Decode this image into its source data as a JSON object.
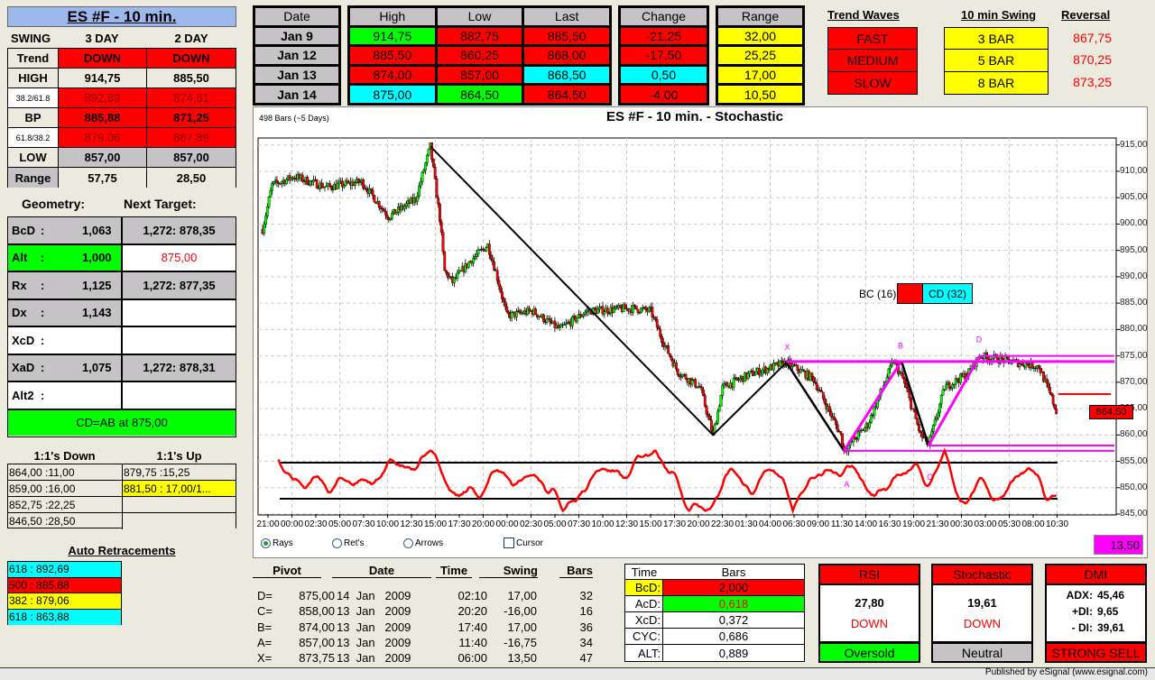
{
  "title": "ES #F - 10 min.",
  "swing": {
    "label": "SWING",
    "col1": "3 DAY",
    "col2": "2 DAY",
    "rows": [
      {
        "label": "Trend",
        "v1": "DOWN",
        "v2": "DOWN",
        "bg": "#ff0000",
        "lbg": "#ece9df",
        "fg": "#000"
      },
      {
        "label": "HIGH",
        "v1": "914,75",
        "v2": "885,50",
        "bg": "#ece9df",
        "lbg": "#ece9df",
        "fg": "#000"
      },
      {
        "label": "38.2/61.8",
        "v1": "892,69",
        "v2": "874,61",
        "bg": "#ff0000",
        "lbg": "#ffffff",
        "fg": "#800000",
        "small": true
      },
      {
        "label": "BP",
        "v1": "885,88",
        "v2": "871,25",
        "bg": "#ff0000",
        "lbg": "#ece9df",
        "fg": "#000"
      },
      {
        "label": "61.8/38.2",
        "v1": "879,06",
        "v2": "867,89",
        "bg": "#ff0000",
        "lbg": "#ffffff",
        "fg": "#800000",
        "small": true
      },
      {
        "label": "LOW",
        "v1": "857,00",
        "v2": "857,00",
        "bg": "#c6c3c6",
        "lbg": "#ece9df",
        "fg": "#000"
      },
      {
        "label": "Range",
        "v1": "57,75",
        "v2": "28,50",
        "bg": "#ece9df",
        "lbg": "#c6c3c6",
        "fg": "#000"
      }
    ]
  },
  "geometry": {
    "label": "Geometry:",
    "next_label": "Next Target:",
    "rows": [
      {
        "name": "BcD",
        "sep": ":",
        "value": "1,063",
        "target": "1,272: 878,35",
        "bg": "#c6c3c6",
        "tbg": "#c6c3c6",
        "tfg": "#000"
      },
      {
        "name": "Alt",
        "sep": ":",
        "value": "1,000",
        "target": "875,00",
        "bg": "#00ff00",
        "tbg": "#ffffff",
        "tfg": "#ff0000"
      },
      {
        "name": "Rx",
        "sep": ":",
        "value": "1,125",
        "target": "1,272: 877,35",
        "bg": "#c6c3c6",
        "tbg": "#c6c3c6",
        "tfg": "#000"
      },
      {
        "name": "Dx",
        "sep": ":",
        "value": "1,143",
        "target": "",
        "bg": "#c6c3c6",
        "tbg": "#ffffff",
        "tfg": "#000"
      },
      {
        "name": "XcD",
        "sep": ":",
        "value": "",
        "target": "",
        "bg": "#ffffff",
        "tbg": "#ffffff",
        "tfg": "#000"
      },
      {
        "name": "XaD",
        "sep": ":",
        "value": "1,075",
        "target": "1,272: 878,31",
        "bg": "#c6c3c6",
        "tbg": "#c6c3c6",
        "tfg": "#000"
      },
      {
        "name": "Alt2",
        "sep": ":",
        "value": "",
        "target": "",
        "bg": "#ffffff",
        "tbg": "#ffffff",
        "tfg": "#000"
      }
    ],
    "footer": "CD=AB at 875,00"
  },
  "ones": {
    "down_label": "1:1's Down",
    "up_label": "1:1's Up",
    "down": [
      "864,00 :11,00",
      "859,00 :16,00",
      "852,75 :22,25",
      "846,50 :28,50"
    ],
    "up": [
      "879,75 :15,25",
      "881,50 : 17,00/1...",
      "",
      ""
    ],
    "up_bg": [
      "#ece9df",
      "#ffff00",
      "#ece9df",
      "#ece9df"
    ]
  },
  "retracements": {
    "label": "Auto Retracements",
    "items": [
      {
        "text": "618 : 892,69",
        "bg": "#00ffff"
      },
      {
        "text": "500 : 885,88",
        "bg": "#ff0000"
      },
      {
        "text": "382 : 879,06",
        "bg": "#ffff00"
      },
      {
        "text": "618 : 863,88",
        "bg": "#00ffff"
      }
    ]
  },
  "daily": {
    "headers": [
      "Date",
      "High",
      "Low",
      "Last",
      "Change",
      "Range"
    ],
    "rows": [
      {
        "date": "Jan  9",
        "high": [
          "914,75",
          "#00ff00"
        ],
        "low": [
          "882,75",
          "#ff0000"
        ],
        "last": [
          "885,50",
          "#ff0000"
        ],
        "change": [
          "-21,25",
          "#ff0000"
        ],
        "range": [
          "32,00",
          "#ffff00"
        ]
      },
      {
        "date": "Jan  12",
        "high": [
          "885,50",
          "#ff0000"
        ],
        "low": [
          "860,25",
          "#ff0000"
        ],
        "last": [
          "868,00",
          "#ff0000"
        ],
        "change": [
          "-17,50",
          "#ff0000"
        ],
        "range": [
          "25,25",
          "#ffff00"
        ]
      },
      {
        "date": "Jan  13",
        "high": [
          "874,00",
          "#ff0000"
        ],
        "low": [
          "857,00",
          "#ff0000"
        ],
        "last": [
          "868,50",
          "#00ffff"
        ],
        "change": [
          "0,50",
          "#00ffff"
        ],
        "range": [
          "17,00",
          "#ffff00"
        ]
      },
      {
        "date": "Jan  14",
        "high": [
          "875,00",
          "#00ffff"
        ],
        "low": [
          "864,50",
          "#00ff00"
        ],
        "last": [
          "864,50",
          "#ff0000"
        ],
        "change": [
          "-4,00",
          "#ff0000"
        ],
        "range": [
          "10,50",
          "#ffff00"
        ]
      }
    ]
  },
  "trend_waves": {
    "label": "Trend Waves",
    "items": [
      "FAST",
      "MEDIUM",
      "SLOW"
    ]
  },
  "swing10": {
    "label": "10 min Swing",
    "items": [
      "3 BAR",
      "5 BAR",
      "8 BAR"
    ]
  },
  "reversal": {
    "label": "Reversal",
    "items": [
      "867,75",
      "870,25",
      "873,25"
    ]
  },
  "chart": {
    "title": "ES #F - 10 min. - Stochastic",
    "bars_info": "498 Bars (~5 Days)",
    "bc_label": "BC (16)",
    "cd_label": "CD (32)",
    "price_tag": "864,50",
    "value_box": "13,50",
    "options": {
      "rays": "Rays",
      "rets": "Ret's",
      "arrows": "Arrows",
      "cursor": "Cursor"
    }
  },
  "chart_data": {
    "type": "candlestick",
    "title": "ES #F - 10 min. - Stochastic",
    "bar_count": 498,
    "ylim": [
      845,
      915
    ],
    "y_ticks": [
      "915,00",
      "910,00",
      "905,00",
      "900,00",
      "895,00",
      "890,00",
      "885,00",
      "880,00",
      "875,00",
      "870,00",
      "865,00",
      "860,00",
      "855,00",
      "850,00",
      "845,00"
    ],
    "x_ticks": [
      "21:00",
      "00:00",
      "02:30",
      "05:00",
      "07:30",
      "10:00",
      "12:30",
      "15:00",
      "17:30",
      "20:00",
      "00:00",
      "02:30",
      "05:00",
      "07:30",
      "10:00",
      "12:30",
      "15:00",
      "17:30",
      "20:00",
      "22:30",
      "01:30",
      "04:00",
      "06:30",
      "09:00",
      "11:30",
      "14:00",
      "16:30",
      "19:00",
      "21:30",
      "00:30",
      "03:00",
      "05:30",
      "08:00",
      "10:30"
    ],
    "grid": true,
    "close_path": [
      [
        0,
        899
      ],
      [
        6,
        907.4
      ],
      [
        20,
        909
      ],
      [
        40,
        907
      ],
      [
        62,
        908
      ],
      [
        79,
        901.4
      ],
      [
        96,
        904.8
      ],
      [
        105,
        914.75
      ],
      [
        111,
        901
      ],
      [
        114,
        891
      ],
      [
        119,
        889
      ],
      [
        130,
        893
      ],
      [
        141,
        896
      ],
      [
        146,
        891
      ],
      [
        153,
        882.6
      ],
      [
        169,
        883.5
      ],
      [
        186,
        880
      ],
      [
        203,
        883.5
      ],
      [
        232,
        884
      ],
      [
        243,
        883.5
      ],
      [
        251,
        877.5
      ],
      [
        260,
        872
      ],
      [
        274,
        869
      ],
      [
        282,
        860
      ],
      [
        288,
        869
      ],
      [
        305,
        871.5
      ],
      [
        328,
        873.75
      ],
      [
        345,
        870.6
      ],
      [
        362,
        860
      ],
      [
        364,
        857
      ],
      [
        379,
        862
      ],
      [
        395,
        874
      ],
      [
        401,
        870.6
      ],
      [
        412,
        860
      ],
      [
        417,
        858
      ],
      [
        427,
        869
      ],
      [
        441,
        871.5
      ],
      [
        449,
        875
      ],
      [
        486,
        873
      ],
      [
        494,
        867
      ],
      [
        497,
        864.5
      ]
    ],
    "pivots": [
      {
        "label": "X",
        "bar": 328,
        "price": 873.75
      },
      {
        "label": "A",
        "bar": 364,
        "price": 857
      },
      {
        "label": "B",
        "bar": 400,
        "price": 874
      },
      {
        "label": "C",
        "bar": 417,
        "price": 858
      },
      {
        "label": "D",
        "bar": 449,
        "price": 875
      }
    ],
    "trend_line": [
      [
        105,
        914.75
      ],
      [
        282,
        860
      ],
      [
        328,
        873.75
      ]
    ],
    "reversal_line": 867.75,
    "stochastic": {
      "upper": 80,
      "lower": 20,
      "last": 19.61
    },
    "colors": {
      "up": "#00ff00",
      "down": "#ff0000",
      "pattern": "#ff00ff",
      "stoch": "#ff0000"
    }
  },
  "pivot_table": {
    "headers": [
      "Pivot",
      "Date",
      "Time",
      "Swing",
      "Bars"
    ],
    "rows": [
      {
        "p": "D=",
        "price": "875,00",
        "date": "14  Jan   2009",
        "time": "02:10",
        "swing": "17,00",
        "bars": "32"
      },
      {
        "p": "C=",
        "price": "858,00",
        "date": "13  Jan   2009",
        "time": "20:20",
        "swing": "-16,00",
        "bars": "16"
      },
      {
        "p": "B=",
        "price": "874,00",
        "date": "13  Jan   2009",
        "time": "17:40",
        "swing": "17,00",
        "bars": "36"
      },
      {
        "p": "A=",
        "price": "857,00",
        "date": "13  Jan   2009",
        "time": "11:40",
        "swing": "-16,75",
        "bars": "34"
      },
      {
        "p": "X=",
        "price": "873,75",
        "date": "13  Jan   2009",
        "time": "06:00",
        "swing": "13,50",
        "bars": "47"
      }
    ]
  },
  "time_bars": {
    "headers": [
      "Time",
      "Bars"
    ],
    "rows": [
      {
        "k": "BcD:",
        "v": "2,000",
        "kbg": "#ffff00",
        "vbg": "#ff0000",
        "vfg": "#000"
      },
      {
        "k": "AcD:",
        "v": "0,618",
        "kbg": "#ffffff",
        "vbg": "#00ff00",
        "vfg": "#ff0000"
      },
      {
        "k": "XcD:",
        "v": "0,372",
        "kbg": "#ffffff",
        "vbg": "#ffffff",
        "vfg": "#000"
      },
      {
        "k": "CYC:",
        "v": "0,686",
        "kbg": "#ffffff",
        "vbg": "#ffffff",
        "vfg": "#000"
      },
      {
        "k": "ALT:",
        "v": "0,889",
        "kbg": "#ffffff",
        "vbg": "#ffffff",
        "vfg": "#000"
      }
    ]
  },
  "rsi": {
    "label": "RSI",
    "value": "27,80",
    "dir": "DOWN",
    "status": "Oversold",
    "status_bg": "#00ff00"
  },
  "stoch": {
    "label": "Stochastic",
    "value": "19,61",
    "dir": "DOWN",
    "status": "Neutral",
    "status_bg": "#c6c3c6"
  },
  "dmi": {
    "label": "DMI",
    "adx_label": "ADX:",
    "adx": "45,46",
    "pdi_label": "+DI:",
    "pdi": "9,65",
    "mdi_label": "- DI:",
    "mdi": "39,61",
    "status": "STRONG SELL",
    "status_bg": "#ff0000"
  },
  "status_bar": "Published by eSignal (www.esignal.com)"
}
